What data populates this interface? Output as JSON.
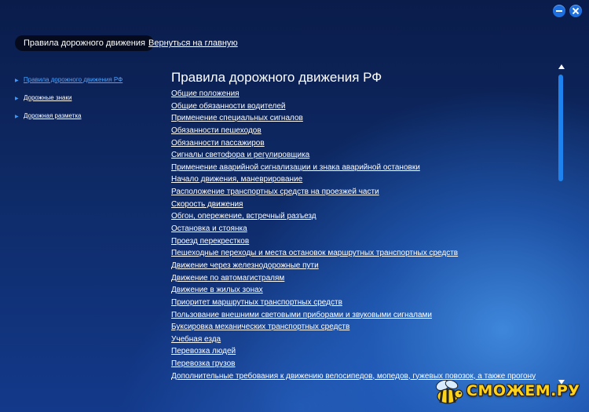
{
  "header": {
    "active_tab": "Правила дорожного движения",
    "back_link": "Вернуться на главную"
  },
  "sidebar": {
    "items": [
      {
        "label": "Правила дорожного движения РФ",
        "active": true
      },
      {
        "label": "Дорожные знаки",
        "active": false
      },
      {
        "label": "Дорожная разметка",
        "active": false
      }
    ]
  },
  "main": {
    "title": "Правила дорожного движения РФ",
    "sections": [
      "Общие положения",
      "Общие обязанности водителей",
      "Применение специальных сигналов",
      "Обязанности пешеходов",
      "Обязанности пассажиров",
      "Сигналы светофора и регулировщика",
      "Применение аварийной сигнализации и знака аварийной остановки",
      "Начало движения, маневрирование",
      "Расположение транспортных средств на проезжей части",
      "Скорость движения",
      "Обгон, опережение, встречный разъезд",
      "Остановка и стоянка",
      "Проезд перекрестков",
      "Пешеходные переходы и места остановок маршрутных транспортных средств",
      "Движение через железнодорожные пути",
      "Движение по автомагистралям",
      "Движение в жилых зонах",
      "Приоритет маршрутных транспортных средств",
      "Пользование внешними световыми приборами и звуковыми сигналами",
      "Буксировка механических транспортных средств",
      "Учебная езда",
      "Перевозка людей",
      "Перевозка грузов",
      "Дополнительные требования к движению велосипедов, мопедов, гужевых повозок, а также прогону"
    ]
  },
  "watermark": {
    "text": "СМОЖЕМ.РУ"
  },
  "icons": {
    "minimize": "minimize-icon",
    "close": "close-icon",
    "sidebar_bullet": "triangle-right-icon",
    "scroll_up": "triangle-up-icon",
    "scroll_down": "triangle-down-icon",
    "watermark_logo": "bee-icon"
  },
  "colors": {
    "accent": "#1e83ee",
    "active_link": "#4aa3ff",
    "active_tab_bg": "#050b1c",
    "watermark": "#ffd21a"
  }
}
